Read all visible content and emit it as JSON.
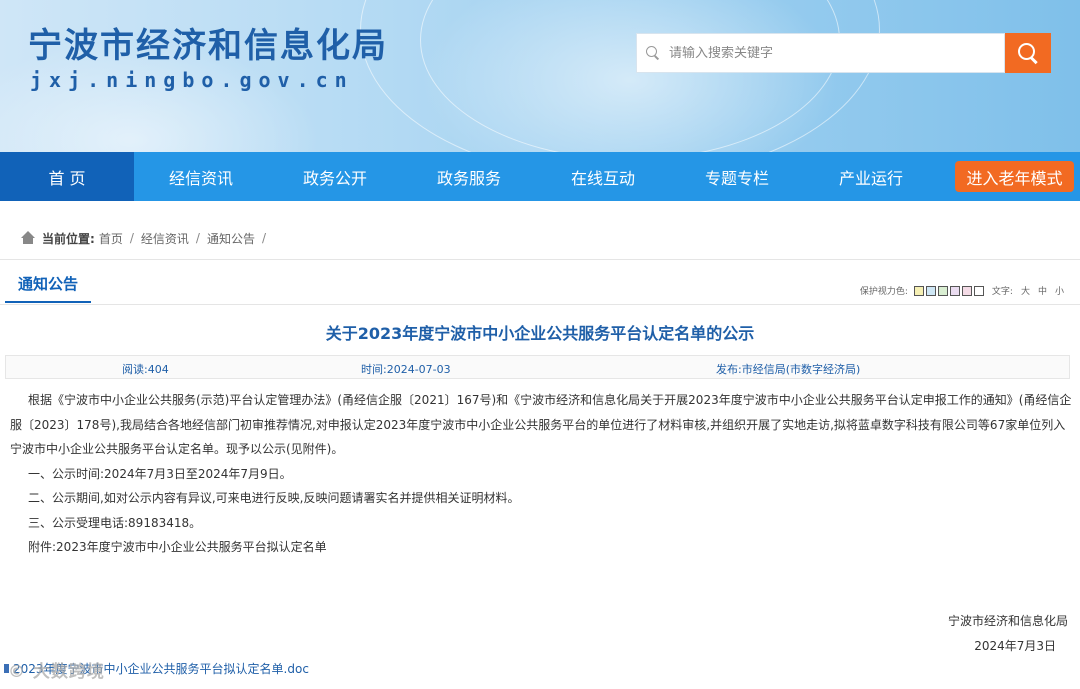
{
  "header": {
    "site_title": "宁波市经济和信息化局",
    "site_domain": "jxj.ningbo.gov.cn",
    "search_placeholder": "请输入搜索关键字"
  },
  "nav": {
    "items": [
      "首 页",
      "经信资讯",
      "政务公开",
      "政务服务",
      "在线互动",
      "专题专栏",
      "产业运行"
    ],
    "elder_mode": "进入老年模式"
  },
  "breadcrumb": {
    "label": "当前位置:",
    "items": [
      "首页",
      "经信资讯",
      "通知公告"
    ],
    "separator": "/"
  },
  "section": {
    "title": "通知公告"
  },
  "tools": {
    "eye_care_label": "保护视力色:",
    "eye_colors": [
      "#f6f0b4",
      "#cfe7f5",
      "#d9eed2",
      "#eadcf0",
      "#f4dbe6",
      "#ffffff"
    ],
    "font_label": "文字:",
    "font_sizes": [
      "大",
      "中",
      "小"
    ]
  },
  "article": {
    "title": "关于2023年度宁波市中小企业公共服务平台认定名单的公示",
    "meta": {
      "views": "阅读:404",
      "time": "时间:2024-07-03",
      "publisher": "发布:市经信局(市数字经济局)"
    },
    "paragraph": "根据《宁波市中小企业公共服务(示范)平台认定管理办法》(甬经信企服〔2021〕167号)和《宁波市经济和信息化局关于开展2023年度宁波市中小企业公共服务平台认定申报工作的通知》(甬经信企服〔2023〕178号),我局结合各地经信部门初审推荐情况,对申报认定2023年度宁波市中小企业公共服务平台的单位进行了材料审核,并组织开展了实地走访,拟将蓝卓数字科技有限公司等67家单位列入宁波市中小企业公共服务平台认定名单。现予以公示(见附件)。",
    "items": [
      "一、公示时间:2024年7月3日至2024年7月9日。",
      "二、公示期间,如对公示内容有异议,可来电进行反映,反映问题请署实名并提供相关证明材料。",
      "三、公示受理电话:89183418。",
      "附件:2023年度宁波市中小企业公共服务平台拟认定名单"
    ],
    "signature": {
      "org": "宁波市经济和信息化局",
      "date": "2024年7月3日"
    },
    "attachment": "2023年度宁波市中小企业公共服务平台拟认定名单.doc"
  },
  "watermark": "© 大数跨境"
}
